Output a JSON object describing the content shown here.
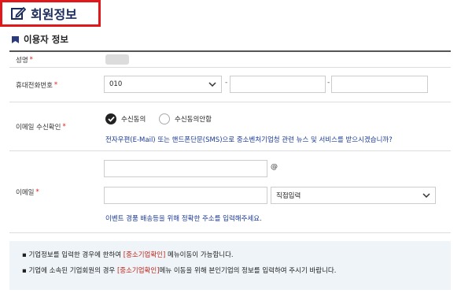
{
  "page_title": "회원정보",
  "section_title": "이용자 정보",
  "required_mark": "*",
  "fields": {
    "name_label": "성명",
    "phone_label": "휴대전화번호",
    "phone_prefix": "010",
    "phone_sep": "-",
    "agree_label": "이메일 수신확인",
    "agree_yes": "수신동의",
    "agree_no": "수신동의안함",
    "agree_note": "전자우편(E-Mail) 또는 핸드폰단문(SMS)으로 중소벤처기업청 관련 뉴스 및 서비스를 받으시겠습니까?",
    "email_label": "이메일",
    "email_at": "@",
    "email_domain_select": "직접입력",
    "email_note": "이벤트 경품 배송등을 위해 정확한 주소를 입력해주세요."
  },
  "notices": [
    {
      "pre": "기업정보를 입력한 경우에 한하여 ",
      "hl": "[중소기업확인]",
      "post": " 메뉴이동이 가능합니다."
    },
    {
      "pre": "기업에 소속된 기업회원의 경우 ",
      "hl": "[중소기업확인]",
      "post": "메뉴 이동을 위해 본인기업의 정보를 입력하여 주시기 바랍니다."
    }
  ],
  "bullet": "▪",
  "colors": {
    "accent_red": "#e0181c",
    "title_navy": "#1a2a5a",
    "note_blue": "#1a3a9a",
    "info_bg": "#eef4f8",
    "highlight": "#c2241c"
  },
  "icons": {
    "title": "edit-icon",
    "section": "section-icon",
    "select": "chevron-down-icon",
    "check": "check-icon"
  }
}
